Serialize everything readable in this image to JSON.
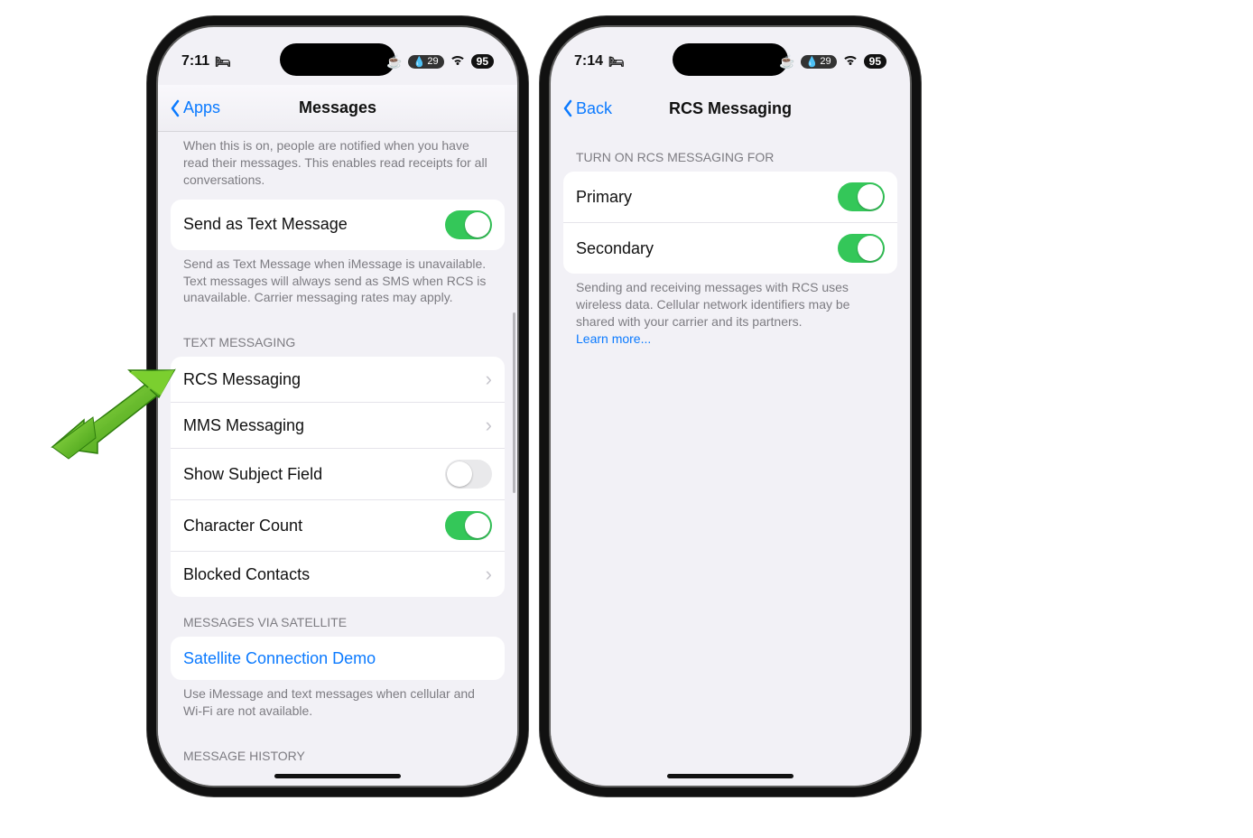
{
  "leftPhone": {
    "status": {
      "time": "7:11",
      "rain": "29",
      "battery": "95"
    },
    "nav": {
      "back": "Apps",
      "title": "Messages"
    },
    "readReceiptsFootnote": "When this is on, people are notified when you have read their messages. This enables read receipts for all conversations.",
    "sendAsText": {
      "label": "Send as Text Message",
      "on": true
    },
    "sendAsTextFootnote": "Send as Text Message when iMessage is unavailable. Text messages will always send as SMS when RCS is unavailable. Carrier messaging rates may apply.",
    "textMsgHeader": "TEXT MESSAGING",
    "rows": {
      "rcs": "RCS Messaging",
      "mms": "MMS Messaging",
      "subject": "Show Subject Field",
      "charCount": "Character Count",
      "blocked": "Blocked Contacts"
    },
    "subjectOn": false,
    "charCountOn": true,
    "satHeader": "MESSAGES VIA SATELLITE",
    "satRow": "Satellite Connection Demo",
    "satFootnote": "Use iMessage and text messages when cellular and Wi-Fi are not available.",
    "historyHeader": "MESSAGE HISTORY"
  },
  "rightPhone": {
    "status": {
      "time": "7:14",
      "rain": "29",
      "battery": "95"
    },
    "nav": {
      "back": "Back",
      "title": "RCS Messaging"
    },
    "sectionHeader": "TURN ON RCS MESSAGING FOR",
    "rows": {
      "primary": {
        "label": "Primary",
        "on": true
      },
      "secondary": {
        "label": "Secondary",
        "on": true
      }
    },
    "footnote": "Sending and receiving messages with RCS uses wireless data. Cellular network identifiers may be shared with your carrier and its partners.",
    "learnMore": "Learn more..."
  }
}
